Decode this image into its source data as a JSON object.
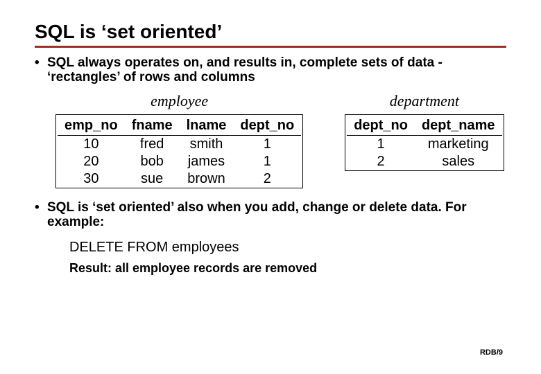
{
  "title": "SQL is ‘set oriented’",
  "bullets": {
    "b1": "SQL always operates on, and results in, complete sets of data - ‘rectangles’ of rows and columns",
    "b2": "SQL is ‘set oriented’ also when you add, change or delete data. For example:"
  },
  "tables": {
    "employee": {
      "caption": "employee",
      "headers": {
        "c0": "emp_no",
        "c1": "fname",
        "c2": "lname",
        "c3": "dept_no"
      },
      "rows": [
        {
          "c0": "10",
          "c1": "fred",
          "c2": "smith",
          "c3": "1"
        },
        {
          "c0": "20",
          "c1": "bob",
          "c2": "james",
          "c3": "1"
        },
        {
          "c0": "30",
          "c1": "sue",
          "c2": "brown",
          "c3": "2"
        }
      ]
    },
    "department": {
      "caption": "department",
      "headers": {
        "c0": "dept_no",
        "c1": "dept_name"
      },
      "rows": [
        {
          "c0": "1",
          "c1": "marketing"
        },
        {
          "c0": "2",
          "c1": "sales"
        }
      ]
    }
  },
  "example": {
    "code": "DELETE FROM employees",
    "result": "Result: all employee records are removed"
  },
  "footer": "RDB/9"
}
